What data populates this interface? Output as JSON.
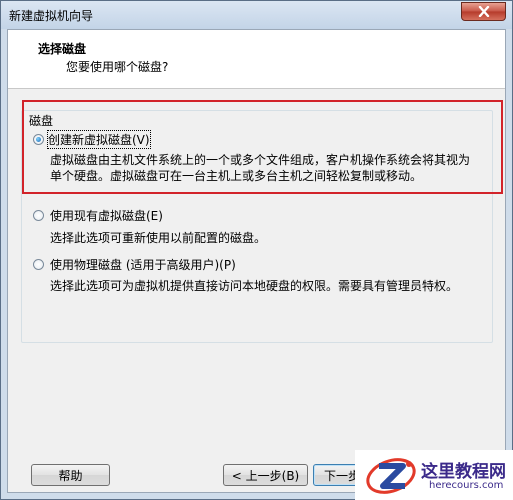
{
  "window": {
    "title": "新建虚拟机向导"
  },
  "header": {
    "title": "选择磁盘",
    "subtitle": "您要使用哪个磁盘?"
  },
  "group": {
    "legend": "磁盘"
  },
  "options": [
    {
      "label": "创建新虚拟磁盘(V)",
      "checked": true,
      "desc": [
        "虚拟磁盘由主机文件系统上的一个或多个文件组成，客户机操作系统会将其视为",
        "单个硬盘。虚拟磁盘可在一台主机上或多台主机之间轻松复制或移动。"
      ]
    },
    {
      "label": "使用现有虚拟磁盘(E)",
      "checked": false,
      "desc": [
        "选择此选项可重新使用以前配置的磁盘。"
      ]
    },
    {
      "label": "使用物理磁盘 (适用于高级用户)(P)",
      "checked": false,
      "desc": [
        "选择此选项可为虚拟机提供直接访问本地硬盘的权限。需要具有管理员特权。"
      ]
    }
  ],
  "buttons": {
    "help": "帮助",
    "back": "< 上一步(B)",
    "next": "下一步"
  },
  "watermark": {
    "cn": "这里教程网",
    "en": "herecours.com"
  },
  "colors": {
    "highlight": "#d2232a",
    "window_frame": "#cfdcea",
    "close": "#c75546"
  }
}
